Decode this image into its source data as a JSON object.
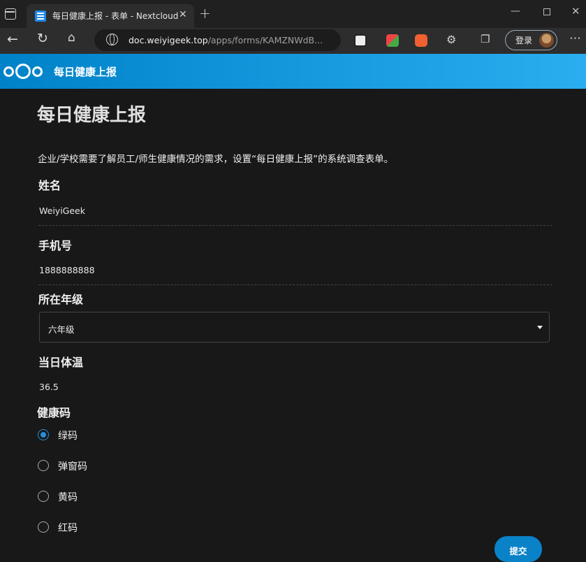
{
  "browser": {
    "tab_title": "每日健康上报 - 表单 - Nextcloud",
    "url_host": "doc.weiyigeek.top",
    "url_path": "/apps/forms/KAMZNWdB...",
    "login_label": "登录"
  },
  "header": {
    "app_title": "每日健康上报"
  },
  "form": {
    "title": "每日健康上报",
    "description": "企业/学校需要了解员工/师生健康情况的需求，设置“每日健康上报”的系统调查表单。",
    "questions": [
      {
        "label": "姓名",
        "answer": "WeiyiGeek"
      },
      {
        "label": "手机号",
        "answer": "1888888888"
      },
      {
        "label": "所在年级",
        "selected": "六年级"
      },
      {
        "label": "当日体温",
        "answer": "36.5"
      },
      {
        "label": "健康码",
        "options": [
          "绿码",
          "弹窗码",
          "黄码",
          "红码"
        ],
        "selected_index": 0
      }
    ],
    "submit_label": "提交"
  },
  "colors": {
    "accent": "#0082c9",
    "radio_checked": "#2a8fd6"
  }
}
